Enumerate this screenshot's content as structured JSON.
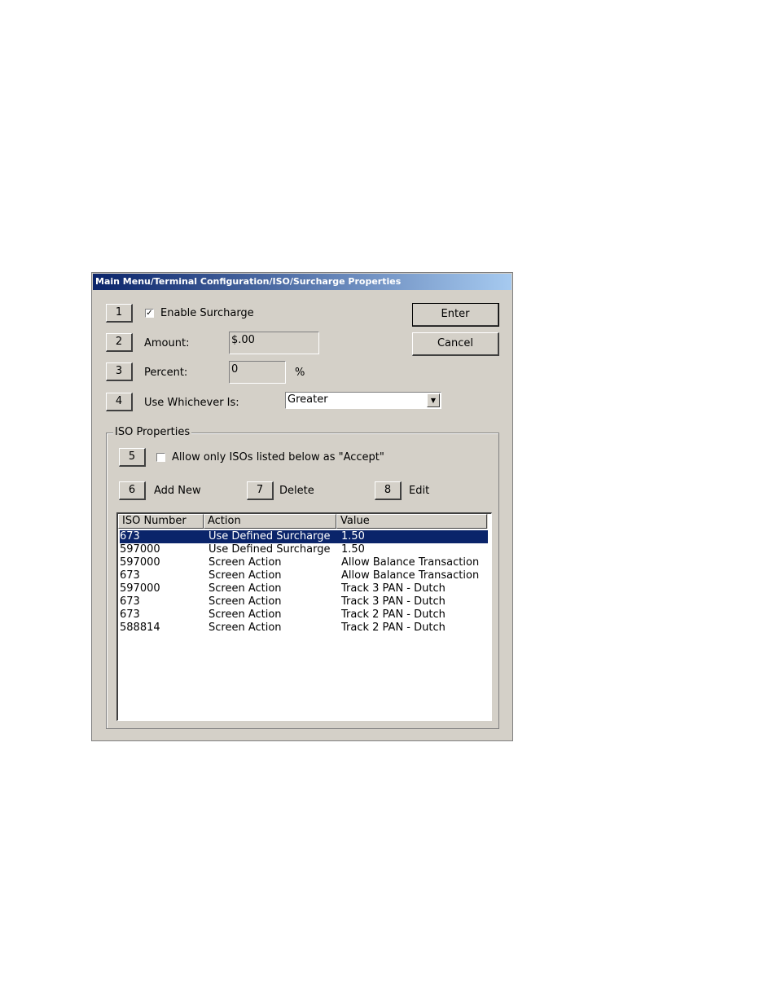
{
  "window": {
    "title": "Main Menu/Terminal Configuration/ISO/Surcharge Properties"
  },
  "options": [
    {
      "num": "1",
      "label": "Enable Surcharge",
      "checked": true
    },
    {
      "num": "2",
      "label": "Amount:",
      "value": "$.00"
    },
    {
      "num": "3",
      "label": "Percent:",
      "value": "0",
      "unit": "%"
    },
    {
      "num": "4",
      "label": "Use Whichever Is:",
      "selected": "Greater"
    }
  ],
  "buttons": {
    "enter": "Enter",
    "cancel": "Cancel"
  },
  "iso_group": {
    "title": "ISO Properties",
    "accept_num": "5",
    "accept_label": "Allow only ISOs listed below as \"Accept\"",
    "accept_checked": false,
    "add": {
      "num": "6",
      "label": "Add New"
    },
    "delete": {
      "num": "7",
      "label": "Delete"
    },
    "edit": {
      "num": "8",
      "label": "Edit"
    }
  },
  "table": {
    "columns": [
      "ISO Number",
      "Action",
      "Value"
    ],
    "rows": [
      {
        "iso": "673",
        "action": "Use Defined Surcharge",
        "value": "1.50",
        "selected": true
      },
      {
        "iso": "597000",
        "action": "Use Defined Surcharge",
        "value": "1.50"
      },
      {
        "iso": "597000",
        "action": "Screen Action",
        "value": "Allow Balance Transaction"
      },
      {
        "iso": "673",
        "action": "Screen Action",
        "value": "Allow Balance Transaction"
      },
      {
        "iso": "597000",
        "action": "Screen Action",
        "value": "Track 3 PAN - Dutch"
      },
      {
        "iso": "673",
        "action": "Screen Action",
        "value": "Track 3 PAN - Dutch"
      },
      {
        "iso": "673",
        "action": "Screen Action",
        "value": "Track 2 PAN - Dutch"
      },
      {
        "iso": "588814",
        "action": "Screen Action",
        "value": "Track 2 PAN - Dutch"
      }
    ]
  },
  "icons": {
    "checkbox_check": "✓",
    "dropdown_arrow": "▼"
  }
}
